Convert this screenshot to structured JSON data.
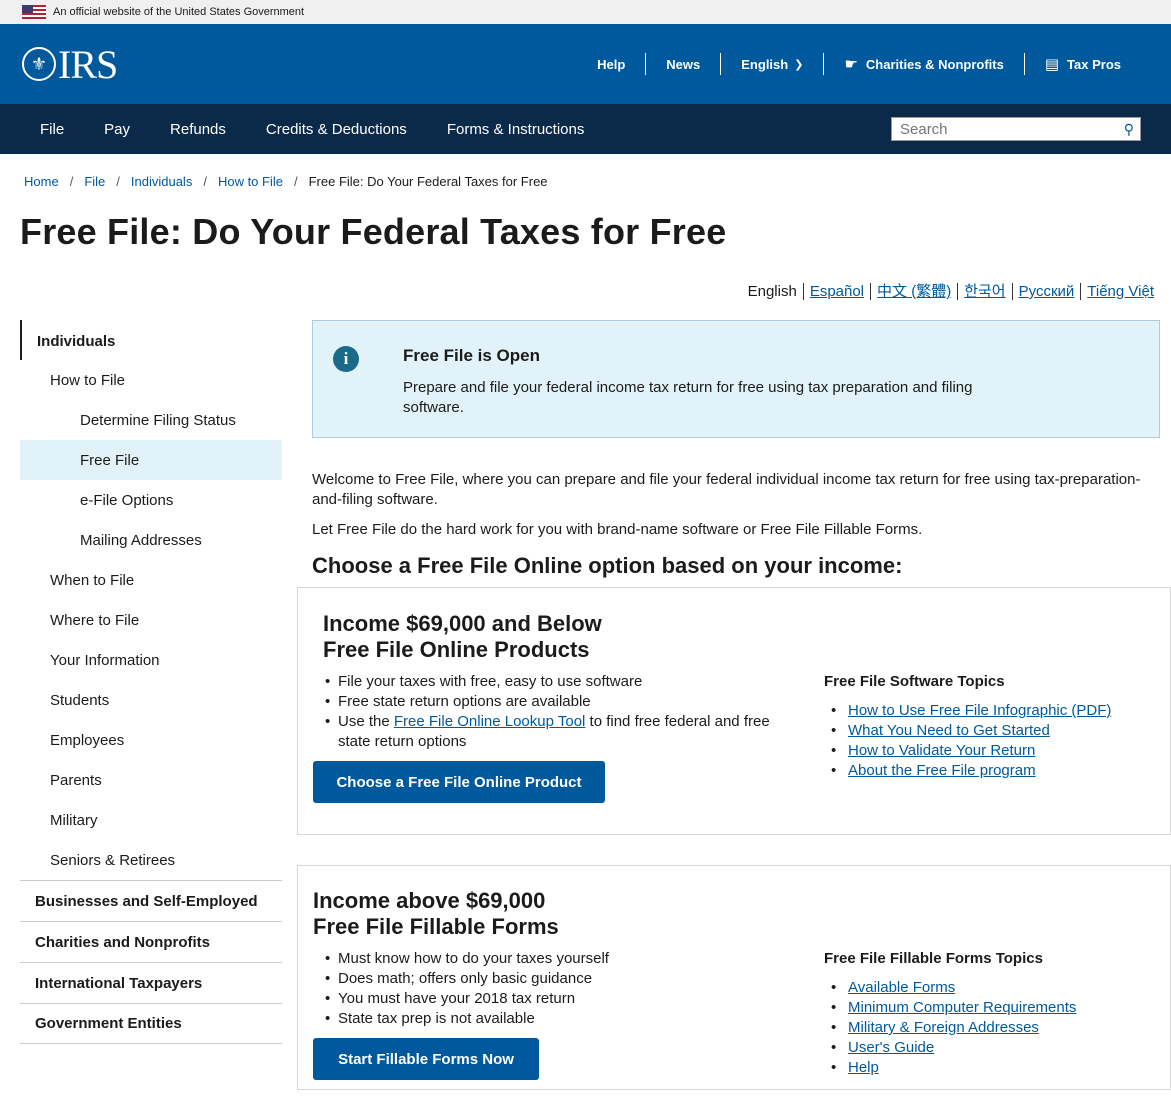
{
  "gov_banner": {
    "text": "An official website of the United States Government"
  },
  "header": {
    "logo_text": "IRS",
    "util_nav": [
      "Help",
      "News",
      "English",
      "Charities & Nonprofits",
      "Tax Pros"
    ]
  },
  "main_nav": {
    "items": [
      "File",
      "Pay",
      "Refunds",
      "Credits & Deductions",
      "Forms & Instructions"
    ],
    "search_placeholder": "Search"
  },
  "breadcrumb": {
    "links": [
      "Home",
      "File",
      "Individuals",
      "How to File"
    ],
    "current": "Free File: Do Your Federal Taxes for Free"
  },
  "page_title": "Free File: Do Your Federal Taxes for Free",
  "languages": {
    "current": "English",
    "links": [
      "Español",
      "中文 (繁體)",
      "한국어",
      "Русский",
      "Tiếng Việt"
    ]
  },
  "sidebar": {
    "top": "Individuals",
    "items": [
      "How to File",
      "Determine Filing Status",
      "Free File",
      "e-File Options",
      "Mailing Addresses",
      "When to File",
      "Where to File",
      "Your Information",
      "Students",
      "Employees",
      "Parents",
      "Military",
      "Seniors & Retirees"
    ],
    "sections": [
      "Businesses and Self-Employed",
      "Charities and Nonprofits",
      "International Taxpayers",
      "Government Entities"
    ]
  },
  "alert": {
    "title": "Free File is Open",
    "body": "Prepare and file your federal income tax return for free using tax preparation and filing software."
  },
  "intro": {
    "p1": "Welcome to Free File, where you can prepare and file your federal individual income tax return for free using tax-preparation-and-filing software.",
    "p2": "Let Free File do the hard work for you with brand-name software or Free File Fillable Forms."
  },
  "choose_heading": "Choose a Free File Online option based on your income:",
  "card1": {
    "title_line1": "Income $69,000 and Below",
    "title_line2": "Free File Online Products",
    "features": [
      "File your taxes with free, easy to use software",
      "Free state return options are available"
    ],
    "lookup_pre": "Use the ",
    "lookup_link": "Free File Online Lookup Tool",
    "lookup_post": " to find free federal and free state return options",
    "button": "Choose a Free File Online Product",
    "topics_heading": "Free File Software Topics",
    "topics": [
      "How to Use Free File Infographic (PDF)",
      "What You Need to Get Started",
      "How to Validate Your Return",
      "About the Free File program"
    ]
  },
  "card2": {
    "title_line1": "Income above $69,000",
    "title_line2": "Free File Fillable Forms",
    "features": [
      "Must know how to do your taxes yourself",
      "Does math; offers only basic guidance",
      "You must have your 2018 tax return",
      "State tax prep is not available"
    ],
    "button": "Start Fillable Forms Now",
    "topics_heading": "Free File Fillable Forms Topics",
    "topics": [
      "Available Forms",
      "Minimum Computer Requirements",
      "Military & Foreign Addresses",
      "User's Guide",
      "Help"
    ]
  }
}
